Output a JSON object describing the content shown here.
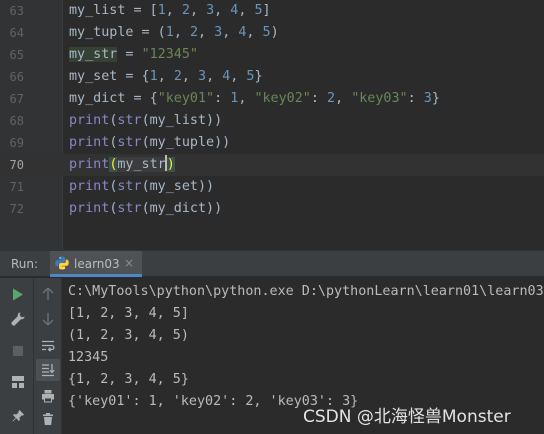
{
  "editor": {
    "lines": [
      {
        "num": "63",
        "text": "my_list = [1, 2, 3, 4, 5]"
      },
      {
        "num": "64",
        "text": "my_tuple = (1, 2, 3, 4, 5)"
      },
      {
        "num": "65",
        "text": "my_str = \"12345\""
      },
      {
        "num": "66",
        "text": "my_set = {1, 2, 3, 4, 5}"
      },
      {
        "num": "67",
        "text": "my_dict = {\"key01\": 1, \"key02\": 2, \"key03\": 3}"
      },
      {
        "num": "68",
        "text": "print(str(my_list))"
      },
      {
        "num": "69",
        "text": "print(str(my_tuple))"
      },
      {
        "num": "70",
        "text": "print(my_str)"
      },
      {
        "num": "71",
        "text": "print(str(my_set))"
      },
      {
        "num": "72",
        "text": "print(str(my_dict))"
      }
    ],
    "current_line": "70"
  },
  "run_panel": {
    "label": "Run:",
    "tab_label": "learn03",
    "tab_close": "×",
    "console_lines": [
      "C:\\MyTools\\python\\python.exe D:\\pythonLearn\\learn01\\learn03",
      "[1, 2, 3, 4, 5]",
      "(1, 2, 3, 4, 5)",
      "12345",
      "{1, 2, 3, 4, 5}",
      "{'key01': 1, 'key02': 2, 'key03': 3}"
    ]
  },
  "watermark": "CSDN @北海怪兽Monster",
  "colors": {
    "accent": "#4a88c7",
    "keyword": "#8888c6",
    "number": "#6897bb",
    "string": "#6a8759",
    "run_green": "#59a869"
  },
  "icons": [
    "python-file-icon",
    "run-icon",
    "wrench-icon",
    "stop-icon",
    "layout-icon",
    "pin-icon",
    "arrow-up-icon",
    "arrow-down-icon",
    "soft-wrap-icon",
    "scroll-to-end-icon",
    "print-icon",
    "trash-icon"
  ]
}
